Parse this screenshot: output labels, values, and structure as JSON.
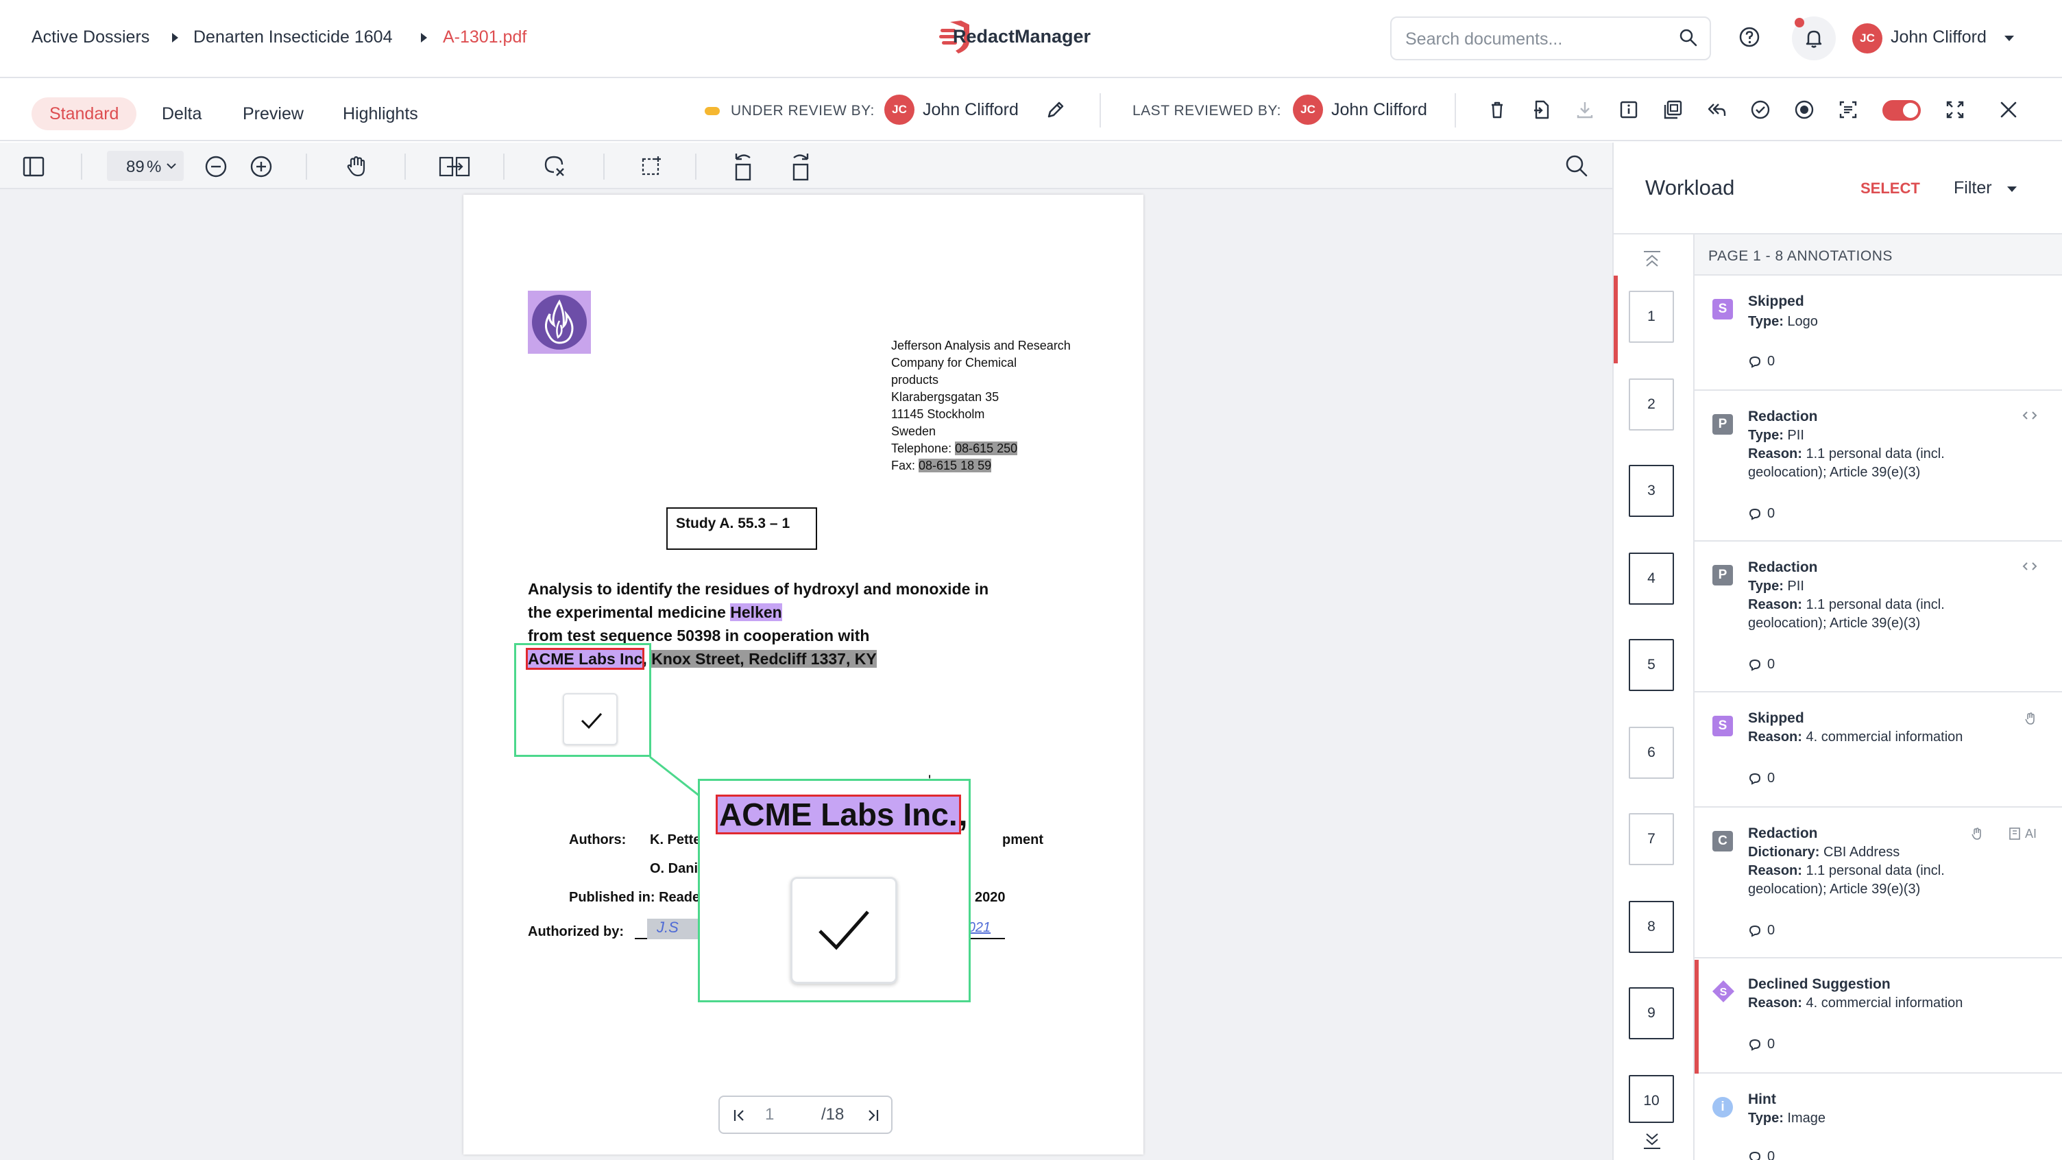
{
  "breadcrumb": {
    "items": [
      "Active Dossiers",
      "Denarten Insecticide 1604",
      "A-1301.pdf"
    ]
  },
  "app": {
    "name": "RedactManager"
  },
  "search": {
    "placeholder": "Search documents..."
  },
  "user": {
    "initials": "JC",
    "name": "John Clifford"
  },
  "view_tabs": [
    "Standard",
    "Delta",
    "Preview",
    "Highlights"
  ],
  "review": {
    "under_review_label": "UNDER REVIEW BY:",
    "under_reviewer": "John Clifford",
    "last_reviewed_label": "LAST REVIEWED BY:",
    "last_reviewer": "John Clifford",
    "initials": "JC"
  },
  "viewer": {
    "zoom": "89",
    "zoom_unit": "%",
    "current_page": "1",
    "total_pages": "/18"
  },
  "document": {
    "address_lines": [
      "Jefferson Analysis and Research",
      "Company for Chemical",
      "products",
      "Klarabergsgatan 35",
      "11145 Stockholm",
      "Sweden"
    ],
    "telephone_label": "Telephone: ",
    "telephone": "08-615 250",
    "fax_label": "Fax: ",
    "fax": "08-615 18 59",
    "study_title": "Study A. 55.3 – 1",
    "heading_line1": "Analysis to identify the residues of hydroxyl and monoxide in",
    "heading_line2_prefix": "the experimental medicine ",
    "heading_line2_highlight": "Helken",
    "heading_line3": "from test sequence 50398 in cooperation with",
    "company": "ACME Labs Inc",
    "company_address": "Knox Street, Redcliff 1337, KY",
    "comma": ",",
    "zoom_company": "ACME Labs Inc.",
    "zoom_comma": ",",
    "authors_label": "Authors:",
    "author1": "K. Pette",
    "author1_tail": "pment",
    "author2": "O. Dani",
    "published_label": "Published in: Reade",
    "published_tail": "2020",
    "authorized_label": "Authorized by:",
    "signature_left": "J.S",
    "signature_right": "3/2021"
  },
  "panel": {
    "title": "Workload",
    "select_label": "SELECT",
    "filter_label": "Filter",
    "page_header": "PAGE 1 - 8 ANNOTATIONS",
    "pages": [
      "1",
      "2",
      "3",
      "4",
      "5",
      "6",
      "7",
      "8",
      "9",
      "10"
    ],
    "annotations": [
      {
        "badge": "S",
        "badge_color": "#b07fe8",
        "title": "Skipped",
        "lines": [
          {
            "k": "Type:",
            "v": " Logo"
          }
        ],
        "comments": "0"
      },
      {
        "badge": "P",
        "badge_color": "#7c828d",
        "title": "Redaction",
        "lines": [
          {
            "k": "Type:",
            "v": " PII"
          },
          {
            "k": "Reason:",
            "v": " 1.1 personal data (incl."
          },
          {
            "k": "",
            "v": "geolocation); Article 39(e)(3)"
          }
        ],
        "comments": "0"
      },
      {
        "badge": "P",
        "badge_color": "#7c828d",
        "title": "Redaction",
        "lines": [
          {
            "k": "Type:",
            "v": " PII"
          },
          {
            "k": "Reason:",
            "v": " 1.1 personal data (incl."
          },
          {
            "k": "",
            "v": "geolocation); Article 39(e)(3)"
          }
        ],
        "comments": "0"
      },
      {
        "badge": "S",
        "badge_color": "#b07fe8",
        "title": "Skipped",
        "lines": [
          {
            "k": "Reason:",
            "v": " 4. commercial information"
          }
        ],
        "comments": "0"
      },
      {
        "badge": "C",
        "badge_color": "#7c828d",
        "title": "Redaction",
        "lines": [
          {
            "k": "Dictionary:",
            "v": " CBI Address"
          },
          {
            "k": "Reason:",
            "v": " 1.1 personal data (incl."
          },
          {
            "k": "",
            "v": "geolocation); Article 39(e)(3)"
          }
        ],
        "comments": "0",
        "ai": "AI"
      },
      {
        "badge": "S",
        "badge_color": "#b07fe8",
        "title": "Declined Suggestion",
        "lines": [
          {
            "k": "Reason:",
            "v": " 4. commercial information"
          }
        ],
        "comments": "0"
      },
      {
        "badge": "i",
        "badge_color": "#9fc3f5",
        "title": "Hint",
        "lines": [
          {
            "k": "Type:",
            "v": " Image"
          }
        ],
        "comments": "0"
      }
    ]
  },
  "colors": {
    "accent": "#dd4d50",
    "highlight_purple": "#c6a4f4",
    "redaction_gray": "#9a9a9a",
    "selection_green": "#4cd88c",
    "toggle": "#dd4d50"
  }
}
